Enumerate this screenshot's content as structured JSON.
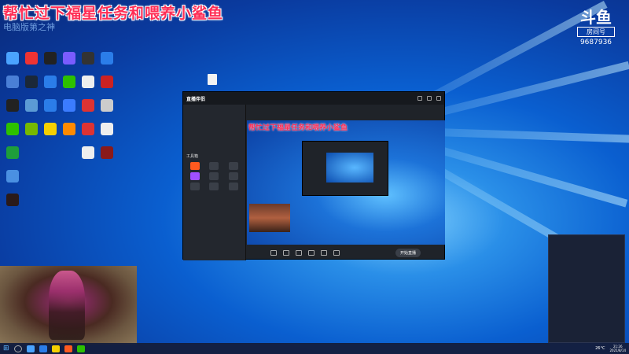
{
  "overlay": {
    "title": "帮忙过下福星任务和喂养小鲨鱼",
    "watermark": "电脑版第之神",
    "douyu_logo": "斗鱼",
    "room_label": "房间号",
    "room_number": "9687936"
  },
  "obs": {
    "brand": "直播伴侣",
    "preview_title": "帮忙过下福星任务和喂养小鲨鱼",
    "go_live_label": "开始直播",
    "tools_title": "工具箱"
  },
  "taskbar": {
    "weather": "26°C",
    "time": "21:26",
    "date": "2021/8/14"
  },
  "colors": {
    "accent_title": "#ff2d55",
    "desktop_bg": "#0a5fd0",
    "app_bg": "#1f2329"
  }
}
